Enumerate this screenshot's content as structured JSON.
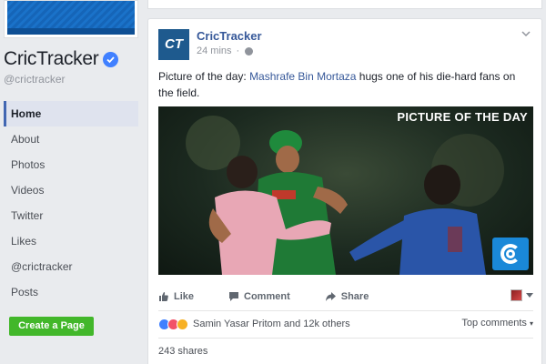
{
  "page": {
    "name": "CricTracker",
    "handle": "@crictracker"
  },
  "nav": {
    "items": [
      {
        "label": "Home",
        "active": true
      },
      {
        "label": "About"
      },
      {
        "label": "Photos"
      },
      {
        "label": "Videos"
      },
      {
        "label": "Twitter"
      },
      {
        "label": "Likes"
      },
      {
        "label": "@crictracker"
      },
      {
        "label": "Posts"
      }
    ],
    "create_page": "Create a Page"
  },
  "post": {
    "logo_text": "CT",
    "author": "CricTracker",
    "time": "24 mins",
    "text_before": "Picture of the day: ",
    "mention": "Mashrafe Bin Mortaza",
    "text_after": " hugs one of his die-hard fans on the field.",
    "photo_caption": "PICTURE OF THE DAY",
    "actions": {
      "like": "Like",
      "comment": "Comment",
      "share": "Share"
    },
    "reactions": "Samin Yasar Pritom and 12k others",
    "top_comments": "Top comments",
    "shares": "243 shares"
  },
  "icons": {
    "verified": "verified-badge-icon",
    "globe": "globe-icon",
    "chevron": "chevron-down-icon",
    "like": "thumbs-up-icon",
    "comment": "comment-icon",
    "share": "share-arrow-icon"
  },
  "colors": {
    "link": "#365899",
    "accent": "#4267b2",
    "green": "#42b72a",
    "background": "#e9ebee"
  }
}
